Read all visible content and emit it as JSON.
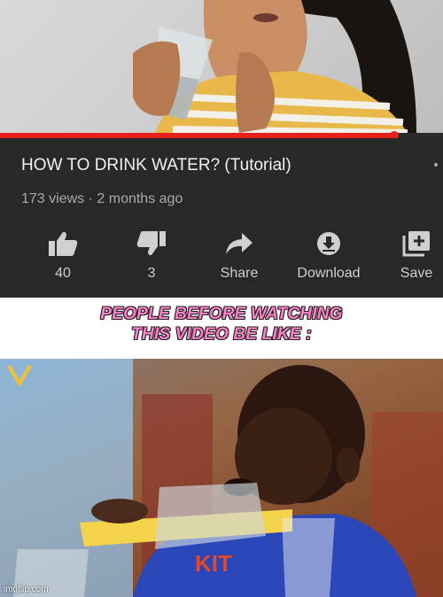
{
  "video": {
    "title": "HOW TO DRINK WATER? (Tutorial)",
    "views": "173 views",
    "separator": "·",
    "age": "2 months ago",
    "progress": 0.89
  },
  "actions": [
    {
      "icon": "thumbs-up-icon",
      "label": "40"
    },
    {
      "icon": "thumbs-down-icon",
      "label": "3"
    },
    {
      "icon": "share-icon",
      "label": "Share"
    },
    {
      "icon": "download-icon",
      "label": "Download"
    },
    {
      "icon": "save-playlist-icon",
      "label": "Save"
    }
  ],
  "caption": {
    "line1": "PEOPLE BEFORE WATCHING",
    "line2": "THIS VIDEO BE LIKE :"
  },
  "watermark": "imgflip.com",
  "colors": {
    "panel": "#282828",
    "progress": "#e3201b",
    "caption": "#ff80c8"
  }
}
